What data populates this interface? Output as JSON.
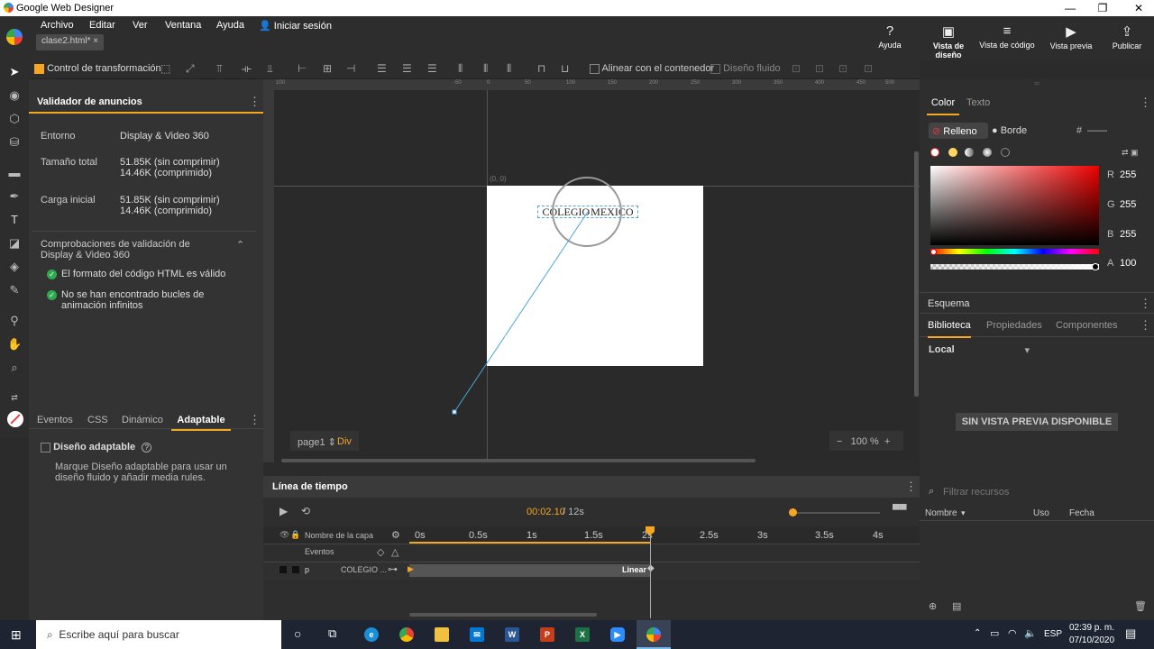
{
  "app": {
    "title": "Google Web Designer",
    "file_tab": "clase2.html*",
    "file_tab_close": "×"
  },
  "menu": [
    "Archivo",
    "Editar",
    "Ver",
    "Ventana",
    "Ayuda",
    "Iniciar sesión"
  ],
  "topbuttons": {
    "help": "Ayuda",
    "design": "Vista de diseño",
    "code": "Vista de código",
    "preview": "Vista previa",
    "publish": "Publicar"
  },
  "toolbar": {
    "transform": "Control de transformación",
    "align_container": "Alinear con el contenedor",
    "fluid": "Diseño fluido"
  },
  "validator": {
    "title": "Validador de anuncios",
    "env_label": "Entorno",
    "env_val": "Display & Video 360",
    "total_label": "Tamaño total",
    "total_v1": "51.85K (sin comprimir)",
    "total_v2": "14.46K (comprimido)",
    "load_label": "Carga inicial",
    "load_v1": "51.85K (sin comprimir)",
    "load_v2": "14.46K (comprimido)",
    "checks_title": "Comprobaciones de validación de Display & Video 360",
    "check1": "El formato del código HTML es válido",
    "check2": "No se han encontrado bucles de animación infinitos"
  },
  "lowertabs": [
    "Eventos",
    "CSS",
    "Dinámico",
    "Adaptable"
  ],
  "adaptable": {
    "title": "Diseño adaptable",
    "desc": "Marque Diseño adaptable para usar un diseño fluido y añadir media rules."
  },
  "stage": {
    "origin": "(0, 0)",
    "text": "COLEGIO MEXICO",
    "page": "page1",
    "element": "Div",
    "zoom": "100 %",
    "zoom_minus": "−",
    "zoom_plus": "+",
    "ruler": [
      "100",
      "-50",
      "0",
      "50",
      "100",
      "150",
      "200",
      "250",
      "300",
      "350",
      "400",
      "450",
      "500",
      "550"
    ]
  },
  "timeline": {
    "title": "Línea de tiempo",
    "time": "00:02.10",
    "total": "/ 12s",
    "col_layer": "Nombre de la capa",
    "events": "Eventos",
    "row_tag": "p",
    "row_name": "COLEGIO ...",
    "linear": "Linear",
    "ticks": [
      "0s",
      "0.5s",
      "1s",
      "1.5s",
      "2s",
      "2.5s",
      "3s",
      "3.5s",
      "4s"
    ],
    "progress": 0.21
  },
  "right": {
    "tab_color": "Color",
    "tab_text": "Texto",
    "fill": "Relleno",
    "border": "Borde",
    "hash": "#",
    "hash_val": "——",
    "r": "255",
    "g": "255",
    "b": "255",
    "a": "100",
    "R": "R",
    "G": "G",
    "B": "B",
    "A": "A",
    "schema": "Esquema",
    "tabs2": [
      "Biblioteca",
      "Propiedades",
      "Componentes"
    ],
    "local": "Local",
    "no_preview": "SIN VISTA PREVIA DISPONIBLE",
    "filter": "Filtrar recursos",
    "col_name": "Nombre",
    "col_use": "Uso",
    "col_date": "Fecha"
  },
  "taskbar": {
    "search": "Escribe aquí para buscar",
    "lang": "ESP",
    "time": "02:39 p. m.",
    "date": "07/10/2020"
  },
  "colors": {
    "accent": "#f5a623",
    "stage_bg": "#2a2a2a",
    "canvas": "#ffffff",
    "selection": "#4aa3df"
  }
}
